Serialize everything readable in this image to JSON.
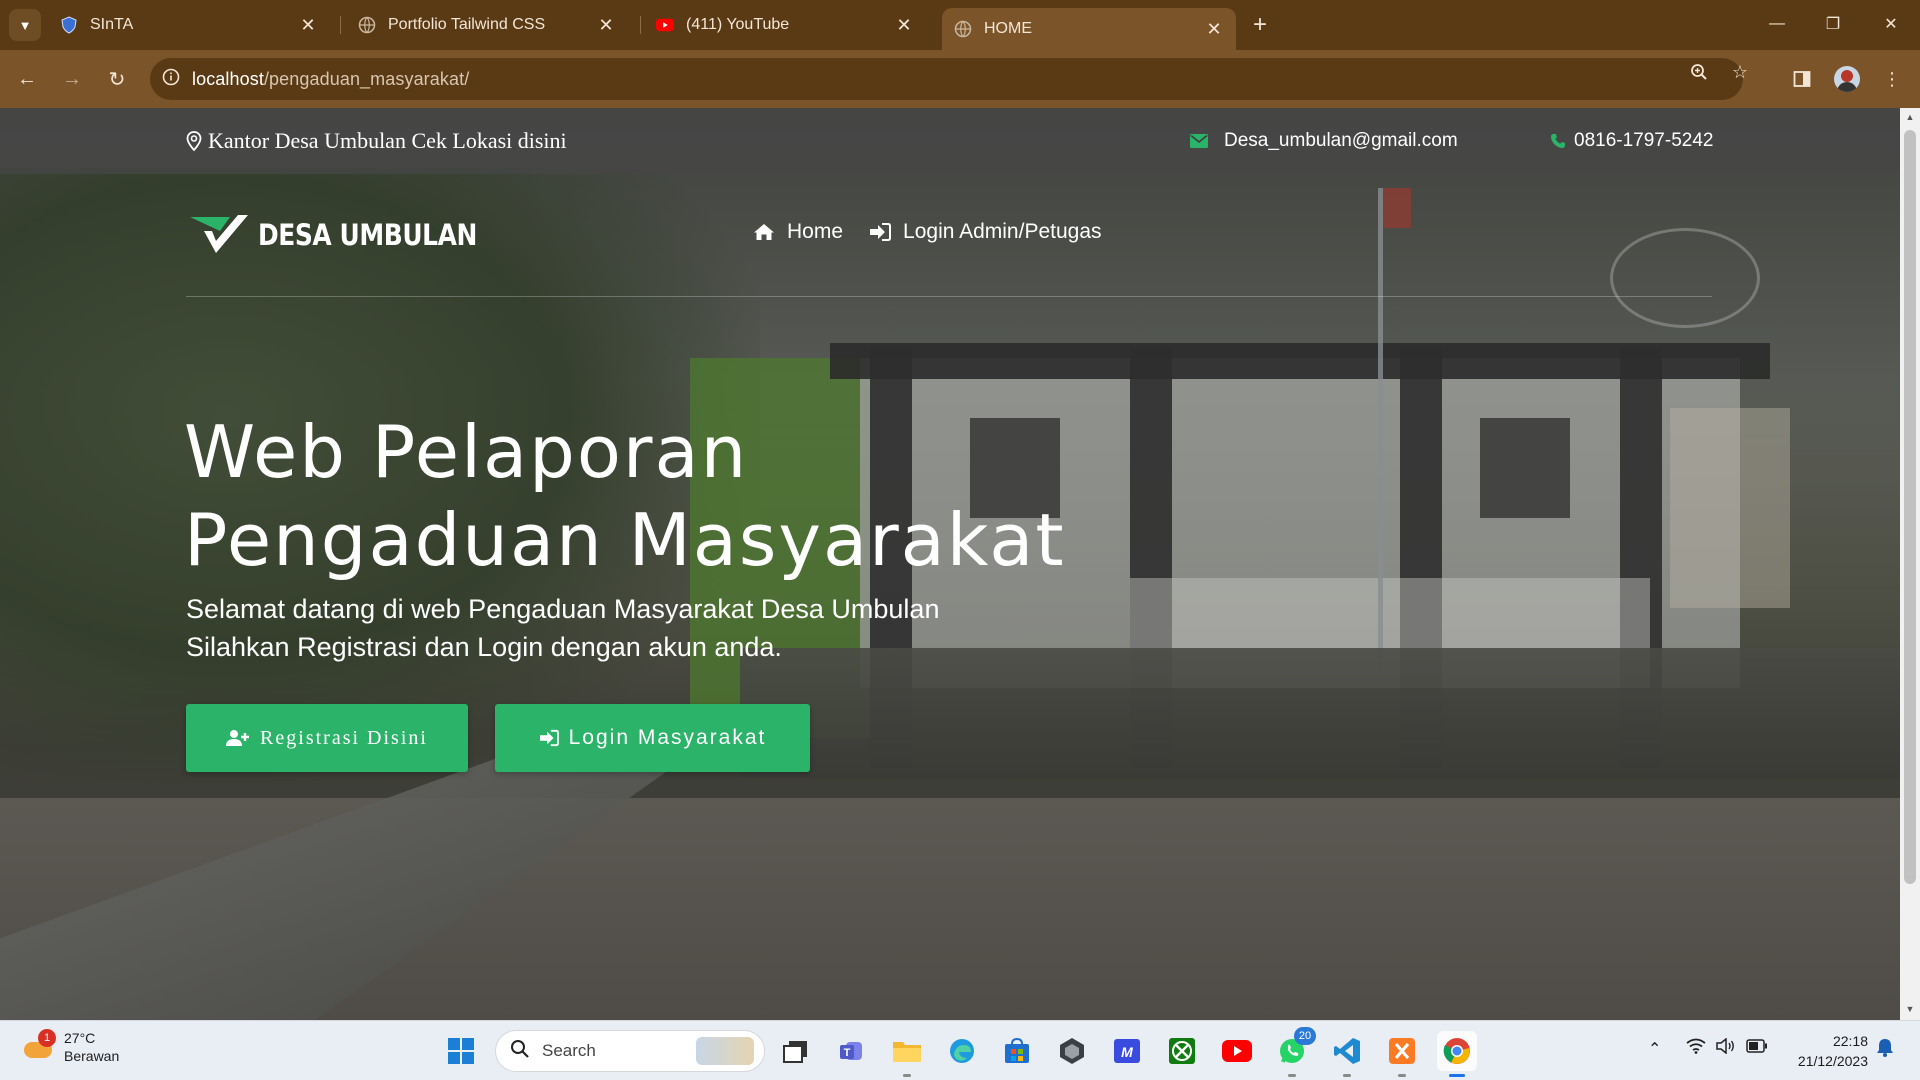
{
  "browser": {
    "tabs": [
      {
        "title": "SInTA",
        "icon": "sinta-shield-icon"
      },
      {
        "title": "Portfolio Tailwind CSS",
        "icon": "globe-icon"
      },
      {
        "title": "(411) YouTube",
        "icon": "youtube-icon"
      },
      {
        "title": "HOME",
        "icon": "globe-icon",
        "active": true
      }
    ],
    "url_host": "localhost",
    "url_path": "/pengaduan_masyarakat/"
  },
  "page": {
    "location_text": "Kantor Desa Umbulan Cek Lokasi disini",
    "email": "Desa_umbulan@gmail.com",
    "phone": "0816-1797-5242",
    "brand": "DESA UMBULAN",
    "nav": {
      "home": "Home",
      "login_admin": "Login Admin/Petugas"
    },
    "hero_title_line1": "Web Pelaporan",
    "hero_title_line2": "Pengaduan Masyarakat",
    "hero_sub_line1": "Selamat datang di web Pengaduan Masyarakat Desa Umbulan",
    "hero_sub_line2": "Silahkan Registrasi dan Login dengan akun anda.",
    "btn_register": "Registrasi Disini",
    "btn_login": "Login Masyarakat",
    "accent_color": "#2bb36a"
  },
  "taskbar": {
    "weather_temp": "27°C",
    "weather_desc": "Berawan",
    "weather_badge": "1",
    "search_label": "Search",
    "whatsapp_badge": "20",
    "time": "22:18",
    "date": "21/12/2023"
  }
}
